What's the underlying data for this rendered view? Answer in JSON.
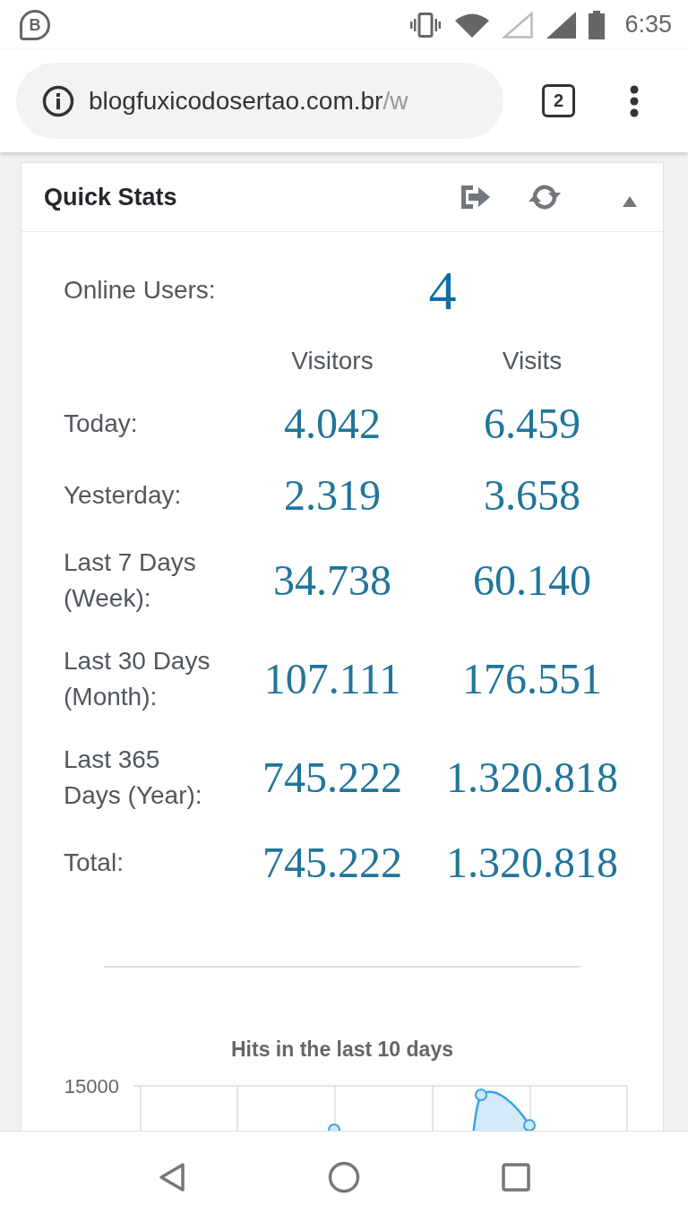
{
  "status_bar": {
    "notification_letter": "B",
    "time": "6:35"
  },
  "browser": {
    "url_host": "blogfuxicodosertao.com.br",
    "url_path": "/w",
    "tab_count": "2"
  },
  "widget": {
    "title": "Quick Stats",
    "expanded": true,
    "online": {
      "label": "Online Users:",
      "value": "4"
    },
    "columns": [
      "Visitors",
      "Visits"
    ],
    "rows": [
      {
        "label_lines": [
          "Today:"
        ],
        "visitors": "4.042",
        "visits": "6.459"
      },
      {
        "label_lines": [
          "Yesterday:"
        ],
        "visitors": "2.319",
        "visits": "3.658"
      },
      {
        "label_lines": [
          "Last 7 Days",
          "(Week):"
        ],
        "visitors": "34.738",
        "visits": "60.140"
      },
      {
        "label_lines": [
          "Last 30 Days",
          "(Month):"
        ],
        "visitors": "107.111",
        "visits": "176.551"
      },
      {
        "label_lines": [
          "Last 365",
          "Days (Year):"
        ],
        "visitors": "745.222",
        "visits": "1.320.818"
      },
      {
        "label_lines": [
          "Total:"
        ],
        "visitors": "745.222",
        "visits": "1.320.818"
      }
    ],
    "chart": {
      "title": "Hits in the last 10 days",
      "y_tick": "15000"
    }
  }
}
